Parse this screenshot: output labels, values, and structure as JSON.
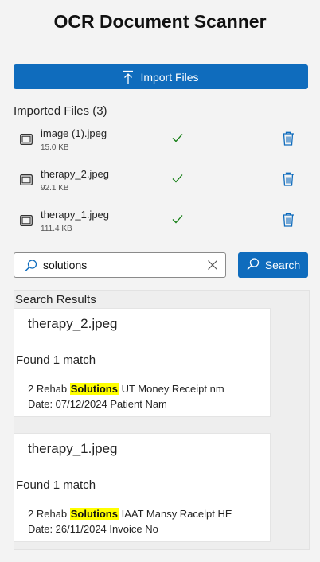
{
  "app": {
    "title": "OCR Document Scanner"
  },
  "import_button": {
    "label": "Import Files",
    "icon": "upload-icon"
  },
  "imported_files": {
    "heading": "Imported Files (3)",
    "items": [
      {
        "name": "image (1).jpeg",
        "size": "15.0 KB",
        "status": "check-icon",
        "action": "trash-icon"
      },
      {
        "name": "therapy_2.jpeg",
        "size": "92.1 KB",
        "status": "check-icon",
        "action": "trash-icon"
      },
      {
        "name": "therapy_1.jpeg",
        "size": "111.4 KB",
        "status": "check-icon",
        "action": "trash-icon"
      }
    ]
  },
  "search": {
    "value": "solutions",
    "button_label": "Search"
  },
  "results": {
    "heading": "Search Results",
    "items": [
      {
        "file": "therapy_2.jpeg",
        "match_count": "Found 1 match",
        "line1_pre": "2 Rehab ",
        "line1_highlight": "Solutions",
        "line1_post": " UT Money Receipt nm",
        "line2": "Date: 07/12/2024 Patient Nam"
      },
      {
        "file": "therapy_1.jpeg",
        "match_count": "Found 1 match",
        "line1_pre": "2 Rehab ",
        "line1_highlight": "Solutions",
        "line1_post": " IAAT Mansy Racelpt HE",
        "line2": "Date: 26/11/2024 Invoice No"
      }
    ]
  },
  "colors": {
    "accent": "#0f6cbd",
    "success": "#107c10",
    "highlight": "#ffff00",
    "background": "#f3f3f3"
  }
}
